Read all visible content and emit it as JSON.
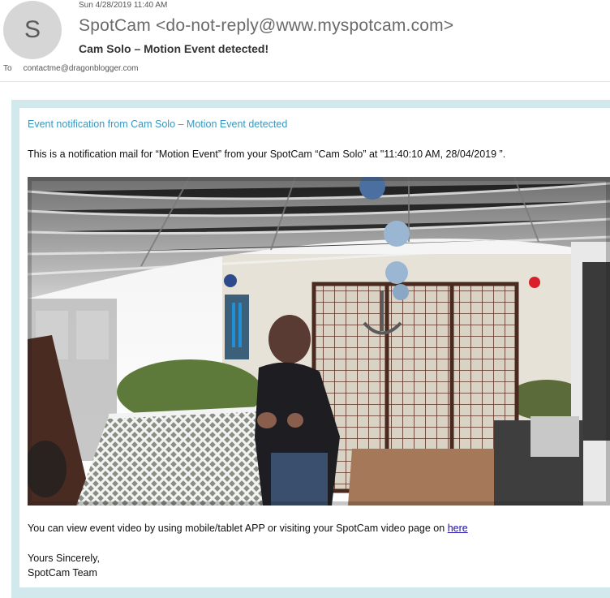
{
  "email": {
    "avatar_letter": "S",
    "date": "Sun 4/28/2019 11:40 AM",
    "sender": "SpotCam <do-not-reply@www.myspotcam.com>",
    "subject": "Cam Solo – Motion Event detected!",
    "to_label": "To",
    "to_address": "contactme@dragonblogger.com"
  },
  "body": {
    "title": "Event notification from Cam Solo – Motion Event detected",
    "intro": "This is a notification mail for “Motion Event” from your SpotCam “Cam Solo” at \"11:40:10 AM, 28/04/2019 ”.",
    "view_text": "You can view event video by using mobile/tablet APP or visiting your SpotCam video page on ",
    "view_link": "here",
    "sign_line1": "Yours Sincerely,",
    "sign_line2": "SpotCam Team"
  },
  "colors": {
    "frame_border": "#d1e9ec",
    "title_blue": "#3a97c0",
    "link_blue": "#1a0dab",
    "avatar_bg": "#d6d6d6"
  }
}
